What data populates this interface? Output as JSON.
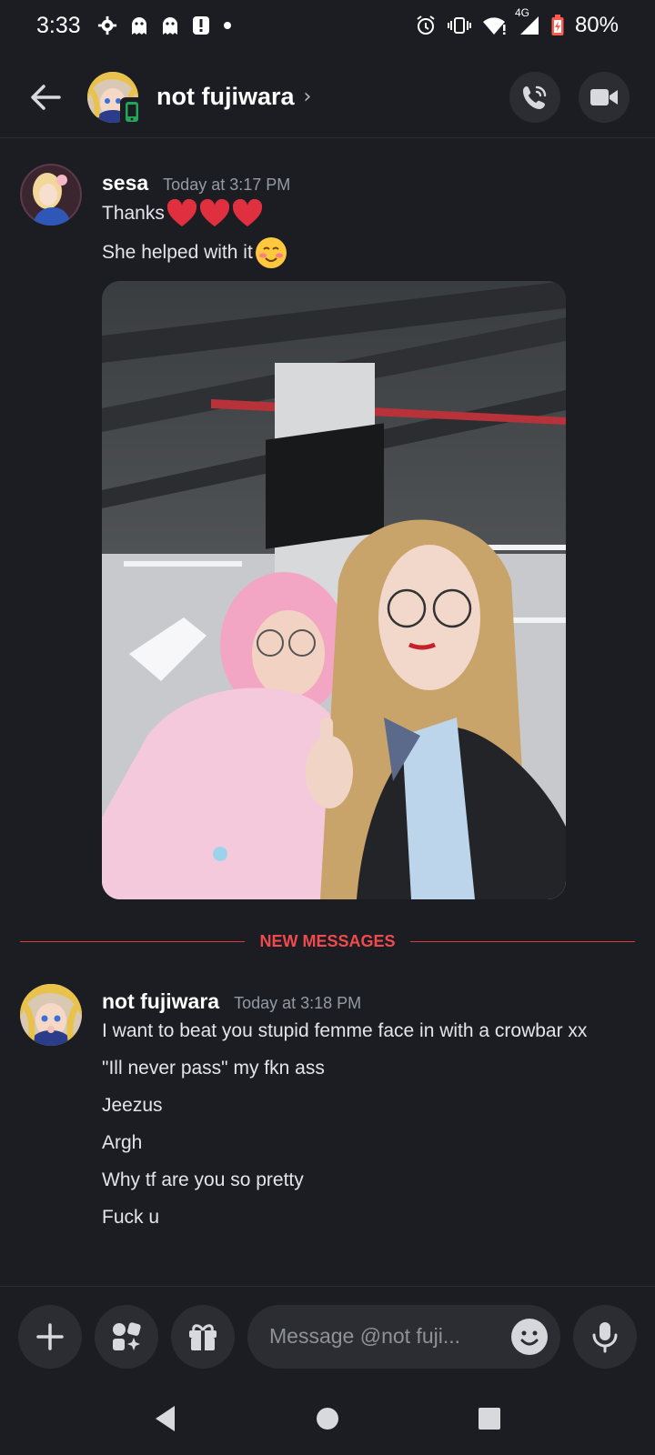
{
  "status_bar": {
    "time": "3:33",
    "network": "4G",
    "battery": "80%"
  },
  "header": {
    "title": "not fujiwara",
    "chevron": "›"
  },
  "messages": [
    {
      "author": "sesa",
      "timestamp": "Today at 3:17 PM",
      "lines": [
        "Thanks",
        "She helped with it"
      ],
      "has_image": true
    },
    {
      "author": "not fujiwara",
      "timestamp": "Today at 3:18 PM",
      "lines": [
        "I want to beat you stupid femme face in with a crowbar xx",
        "\"Ill never pass\" my fkn ass",
        "Jeezus",
        "Argh",
        "Why tf are you so pretty",
        "Fuck u"
      ]
    }
  ],
  "divider": {
    "label": "NEW MESSAGES"
  },
  "composer": {
    "placeholder": "Message @not fuji..."
  },
  "colors": {
    "accent_red": "#d83c3e",
    "background": "#1c1d22"
  }
}
